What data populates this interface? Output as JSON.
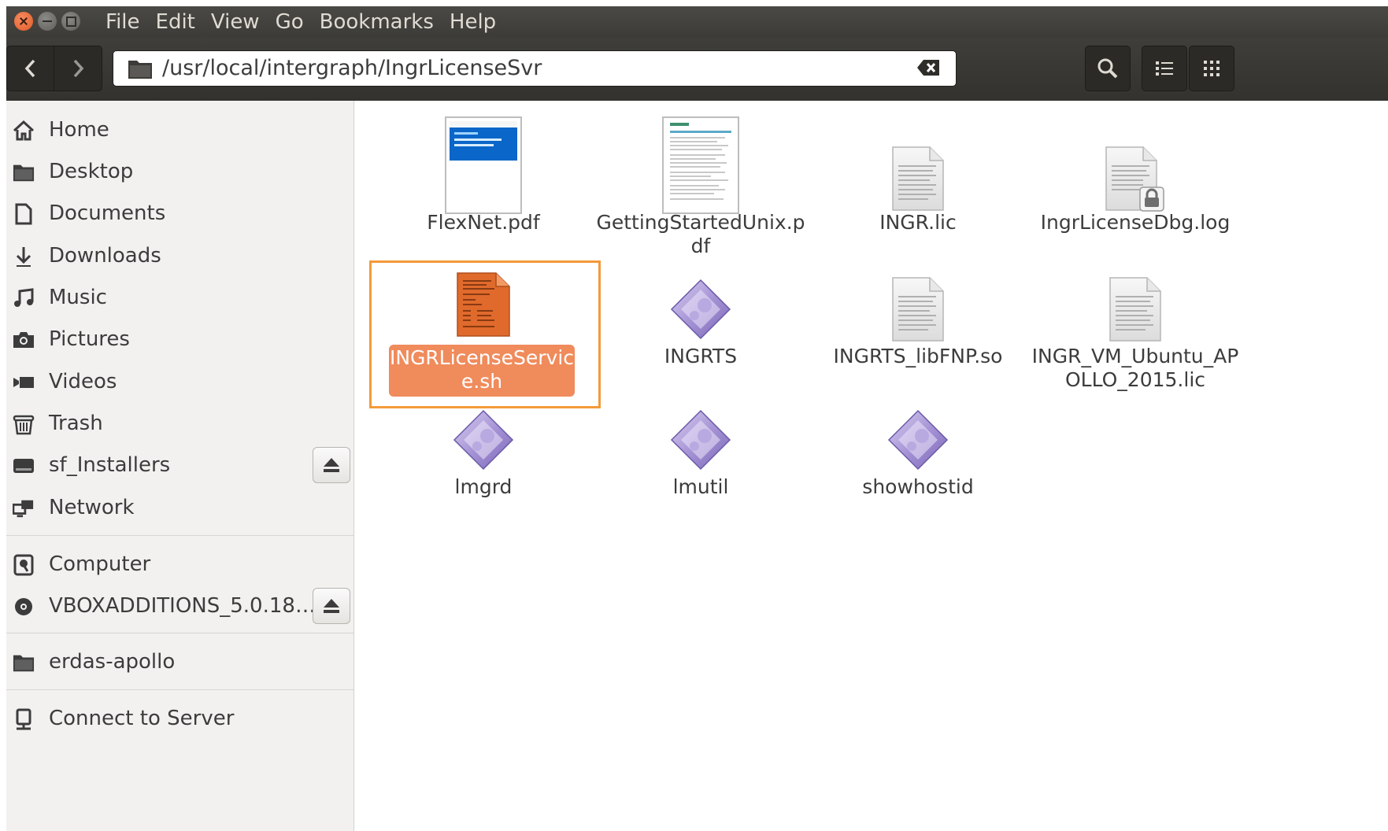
{
  "menubar": {
    "items": [
      "File",
      "Edit",
      "View",
      "Go",
      "Bookmarks",
      "Help"
    ]
  },
  "toolbar": {
    "path": "/usr/local/intergraph/IngrLicenseSvr"
  },
  "sidebar": {
    "items": [
      {
        "label": "Home",
        "icon": "home-icon"
      },
      {
        "label": "Desktop",
        "icon": "folder-icon"
      },
      {
        "label": "Documents",
        "icon": "document-icon"
      },
      {
        "label": "Downloads",
        "icon": "download-icon"
      },
      {
        "label": "Music",
        "icon": "music-icon"
      },
      {
        "label": "Pictures",
        "icon": "camera-icon"
      },
      {
        "label": "Videos",
        "icon": "video-icon"
      },
      {
        "label": "Trash",
        "icon": "trash-icon"
      },
      {
        "label": "sf_Installers",
        "icon": "drive-icon"
      },
      {
        "label": "Network",
        "icon": "network-icon"
      },
      {
        "label": "Computer",
        "icon": "computer-icon"
      },
      {
        "label": "VBOXADDITIONS_5.0.18…",
        "icon": "disc-icon"
      },
      {
        "label": "erdas-apollo",
        "icon": "folder-icon"
      },
      {
        "label": "Connect to Server",
        "icon": "server-icon"
      }
    ]
  },
  "files": [
    {
      "name": "FlexNet.pdf",
      "type": "pdf-thumbnail"
    },
    {
      "name": "GettingStartedUnix.pdf",
      "type": "pdf-thumbnail"
    },
    {
      "name": "INGR.lic",
      "type": "text-file"
    },
    {
      "name": "IngrLicenseDbg.log",
      "type": "locked-text-file"
    },
    {
      "name": "INGRLicenseService.sh",
      "type": "shell-script",
      "selected": true
    },
    {
      "name": "INGRTS",
      "type": "executable"
    },
    {
      "name": "INGRTS_libFNP.so",
      "type": "text-file"
    },
    {
      "name": "INGR_VM_Ubuntu_APOLLO_2015.lic",
      "type": "text-file"
    },
    {
      "name": "lmgrd",
      "type": "executable"
    },
    {
      "name": "lmutil",
      "type": "executable"
    },
    {
      "name": "showhostid",
      "type": "executable"
    }
  ],
  "colors": {
    "selection": "#f08b5c",
    "highlight_border": "#f39a3a",
    "titlebar": "#3c3b37"
  }
}
